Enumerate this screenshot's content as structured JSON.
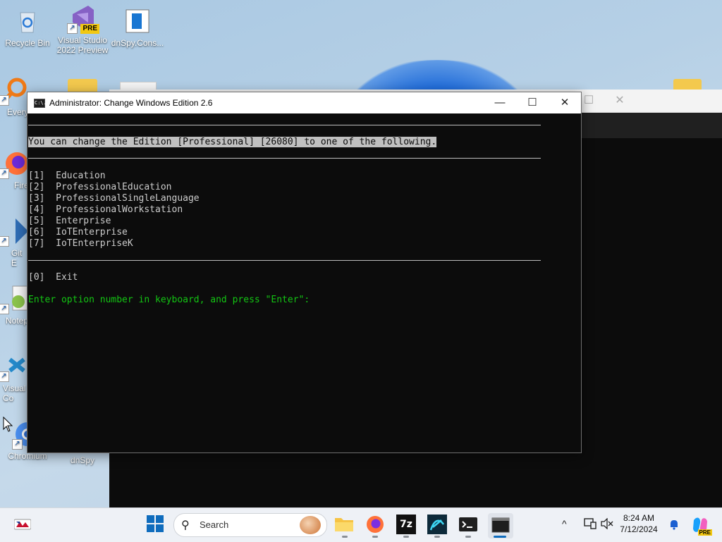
{
  "desktop": {
    "icons": [
      {
        "label": "Recycle Bin"
      },
      {
        "label": "Visual Studio 2022 Preview",
        "badge": "PRE"
      },
      {
        "label": "dnSpy.Cons..."
      },
      {
        "label": "Every"
      },
      {
        "label": "Fire"
      },
      {
        "label": "Git E"
      },
      {
        "label": "Notep"
      },
      {
        "label": "Visual Co"
      },
      {
        "label": "Chromium"
      },
      {
        "label": "dnSpy"
      }
    ]
  },
  "window": {
    "title": "Administrator:  Change Windows Edition 2.6",
    "icon_text": "C:\\.",
    "minimize": "—",
    "maximize": "☐",
    "close": "✕"
  },
  "console": {
    "prompt_line": "You can change the Edition [Professional] [26080] to one of the following.",
    "options": [
      "[1]  Education",
      "[2]  ProfessionalEducation",
      "[3]  ProfessionalSingleLanguage",
      "[4]  ProfessionalWorkstation",
      "[5]  Enterprise",
      "[6]  IoTEnterprise",
      "[7]  IoTEnterpriseK"
    ],
    "exit_option": "[0]  Exit",
    "input_prompt": "Enter option number in keyboard, and press \"Enter\":"
  },
  "taskbar": {
    "search_label": "Search",
    "time": "8:24 AM",
    "date": "7/12/2024",
    "tray_chevron": "^",
    "seven_zip": "7z",
    "copilot_badge": "PRE"
  },
  "colors": {
    "console_bg": "#0c0c0c",
    "console_text": "#cccccc",
    "highlight": "#c0c0c0",
    "green": "#13c513"
  }
}
